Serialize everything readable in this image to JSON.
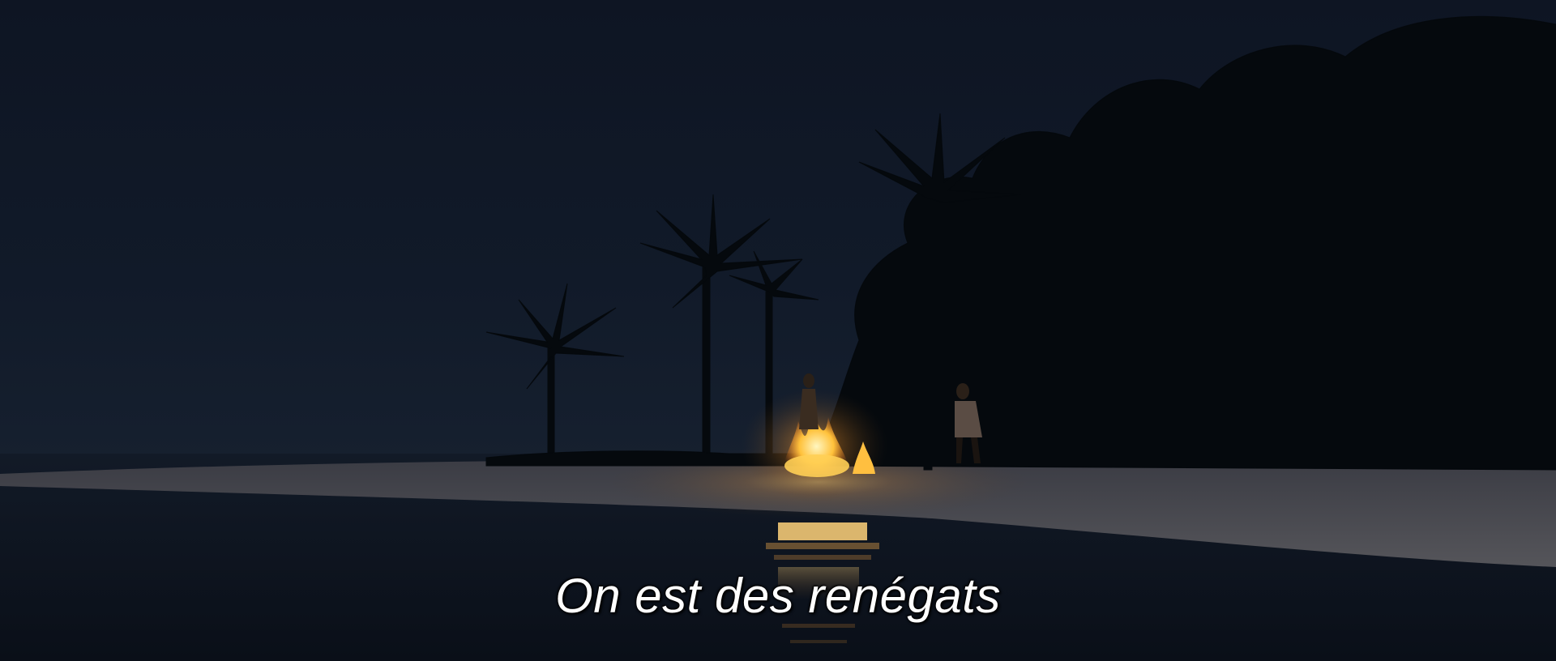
{
  "subtitle": {
    "text": "On est des renégats",
    "color": "#ffffff"
  },
  "scene": {
    "description_colors": {
      "sky": "#0f1726",
      "sea": "#0c121d",
      "sand": "#4b4a4e",
      "fire": "#ffb020",
      "silhouette": "#05080b"
    }
  }
}
